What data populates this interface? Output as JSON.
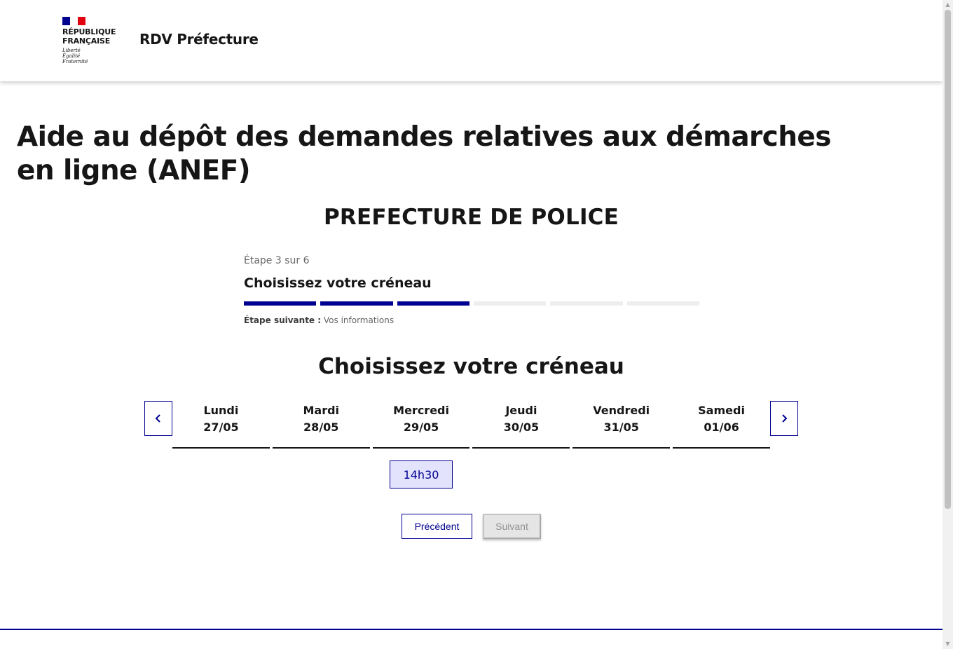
{
  "header": {
    "logo_title": "RÉPUBLIQUE\nFRANÇAISE",
    "logo_motto": "Liberté\nÉgalité\nFraternité",
    "service_name": "RDV Préfecture"
  },
  "main": {
    "title": "Aide au dépôt des demandes relatives aux démarches en ligne (ANEF)",
    "prefecture": "PREFECTURE DE POLICE"
  },
  "stepper": {
    "state": "Étape 3 sur 6",
    "title": "Choisissez votre créneau",
    "current_step": 3,
    "total_steps": 6,
    "next_label": "Étape suivante :",
    "next_value": "Vos informations"
  },
  "slots": {
    "heading": "Choisissez votre créneau",
    "days": [
      {
        "name": "Lundi",
        "date": "27/05"
      },
      {
        "name": "Mardi",
        "date": "28/05"
      },
      {
        "name": "Mercredi",
        "date": "29/05"
      },
      {
        "name": "Jeudi",
        "date": "30/05"
      },
      {
        "name": "Vendredi",
        "date": "31/05"
      },
      {
        "name": "Samedi",
        "date": "01/06"
      }
    ],
    "available": [
      {
        "day": "Mercredi",
        "time": "14h30"
      }
    ]
  },
  "actions": {
    "previous": "Précédent",
    "next": "Suivant"
  },
  "colors": {
    "primary": "#000091",
    "slot_background": "#e3e3fd",
    "disabled_background": "#e5e5e5",
    "disabled_text": "#929292"
  }
}
